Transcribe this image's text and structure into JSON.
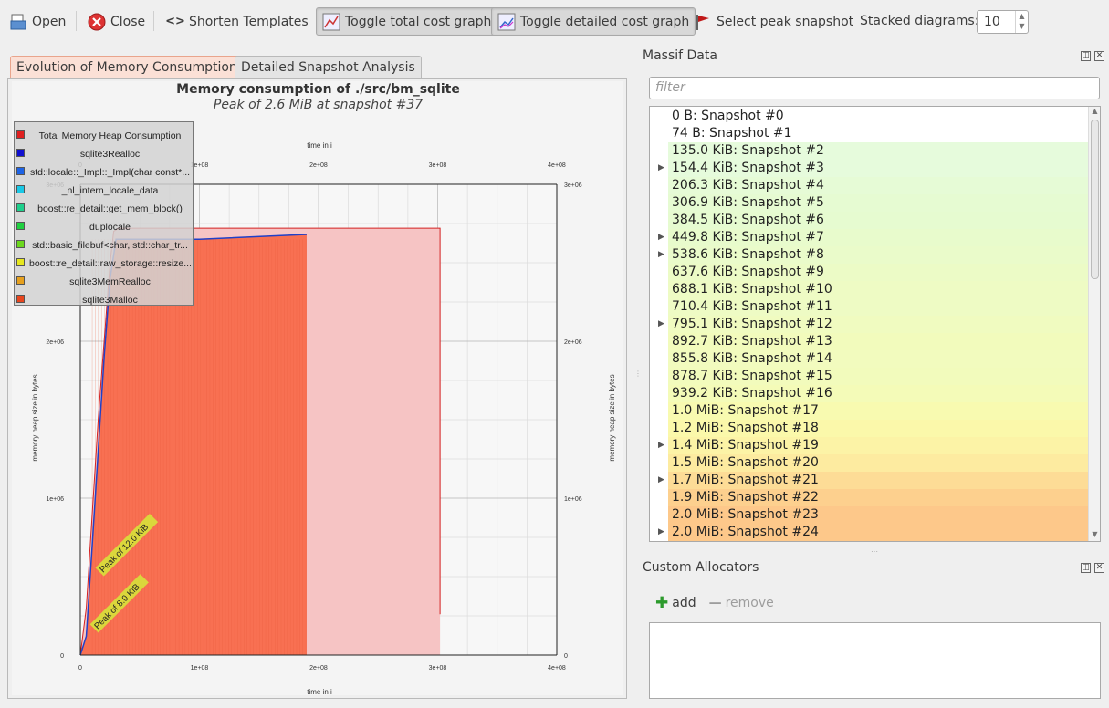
{
  "toolbar": {
    "open_label": "Open",
    "close_label": "Close",
    "shorten_label": "Shorten Templates",
    "toggle_total_label": "Toggle total cost graph",
    "toggle_detailed_label": "Toggle detailed cost graph",
    "select_peak_label": "Select peak snapshot",
    "stacked_label": "Stacked diagrams:",
    "stacked_value": "10"
  },
  "tabs": [
    {
      "label": "Evolution of Memory Consumption",
      "active": true
    },
    {
      "label": "Detailed Snapshot Analysis",
      "active": false
    }
  ],
  "chart": {
    "title": "Memory consumption of ./src/bm_sqlite",
    "subtitle": "Peak of 2.6 MiB at snapshot #37",
    "x_label_top": "time in i",
    "x_label_bottom": "time in i",
    "y_label_left": "memory heap size in bytes",
    "y_label_right": "memory heap size in bytes",
    "x_ticks": [
      "0",
      "1e+08",
      "2e+08",
      "3e+08",
      "4e+08"
    ],
    "y_ticks": [
      "0",
      "1e+06",
      "2e+06",
      "3e+06"
    ],
    "annotations": [
      "Peak of 12.0 KiB",
      "Peak of 8.0 KiB"
    ],
    "legend": [
      {
        "label": "Total Memory Heap Consumption",
        "color": "#e02020"
      },
      {
        "label": "sqlite3Realloc",
        "color": "#1010d0"
      },
      {
        "label": "std::locale::_Impl::_Impl(char const*...",
        "color": "#1e64e6"
      },
      {
        "label": "_nl_intern_locale_data",
        "color": "#19c8e6"
      },
      {
        "label": "boost::re_detail::get_mem_block()",
        "color": "#1ecf8c"
      },
      {
        "label": "duplocale",
        "color": "#20d040"
      },
      {
        "label": "std::basic_filebuf<char, std::char_tr...",
        "color": "#6cd81e"
      },
      {
        "label": "boost::re_detail::raw_storage::resize...",
        "color": "#e6e61e"
      },
      {
        "label": "sqlite3MemRealloc",
        "color": "#e6a01e"
      },
      {
        "label": "sqlite3Malloc",
        "color": "#e8461e"
      }
    ]
  },
  "chart_data": {
    "type": "area",
    "title": "Memory consumption of ./src/bm_sqlite",
    "subtitle": "Peak of 2.6 MiB at snapshot #37",
    "xlabel": "time in i",
    "ylabel": "memory heap size in bytes",
    "xlim": [
      0,
      400000000
    ],
    "ylim": [
      0,
      3000000
    ],
    "grid": true,
    "legend_position": "top-left",
    "series": [
      {
        "name": "Total Memory Heap Consumption",
        "x": [
          0,
          5000000,
          10000000,
          15000000,
          20000000,
          25000000,
          28000000,
          32000000,
          190000000,
          302000000,
          302000000
        ],
        "y": [
          0,
          300000,
          900000,
          1500000,
          2000000,
          2500000,
          2700000,
          2720000,
          2720000,
          2720000,
          260000
        ]
      },
      {
        "name": "sqlite3Realloc",
        "x": [
          0,
          5000000,
          10000000,
          15000000,
          20000000,
          25000000,
          30000000,
          100000000,
          190000000
        ],
        "y": [
          0,
          120000,
          700000,
          1300000,
          1900000,
          2400000,
          2650000,
          2650000,
          2680000
        ]
      }
    ]
  },
  "massif": {
    "title": "Massif Data",
    "filter_placeholder": "filter",
    "snapshots": [
      {
        "label": "0 B: Snapshot #0",
        "expandable": false,
        "color": "#ffffff"
      },
      {
        "label": "74 B: Snapshot #1",
        "expandable": false,
        "color": "#ffffff"
      },
      {
        "label": "135.0 KiB: Snapshot #2",
        "expandable": false,
        "color": "#e6fbdc"
      },
      {
        "label": "154.4 KiB: Snapshot #3",
        "expandable": true,
        "color": "#e6fbdc"
      },
      {
        "label": "206.3 KiB: Snapshot #4",
        "expandable": false,
        "color": "#e6fbd6"
      },
      {
        "label": "306.9 KiB: Snapshot #5",
        "expandable": false,
        "color": "#e6fbd2"
      },
      {
        "label": "384.5 KiB: Snapshot #6",
        "expandable": false,
        "color": "#e6fbd0"
      },
      {
        "label": "449.8 KiB: Snapshot #7",
        "expandable": true,
        "color": "#e8fbcc"
      },
      {
        "label": "538.6 KiB: Snapshot #8",
        "expandable": true,
        "color": "#eafbca"
      },
      {
        "label": "637.6 KiB: Snapshot #9",
        "expandable": false,
        "color": "#ecfbc6"
      },
      {
        "label": "688.1 KiB: Snapshot #10",
        "expandable": false,
        "color": "#eefbc4"
      },
      {
        "label": "710.4 KiB: Snapshot #11",
        "expandable": false,
        "color": "#eefbc4"
      },
      {
        "label": "795.1 KiB: Snapshot #12",
        "expandable": true,
        "color": "#f0fbc0"
      },
      {
        "label": "892.7 KiB: Snapshot #13",
        "expandable": false,
        "color": "#f2fbbc"
      },
      {
        "label": "855.8 KiB: Snapshot #14",
        "expandable": false,
        "color": "#f2fbbe"
      },
      {
        "label": "878.7 KiB: Snapshot #15",
        "expandable": false,
        "color": "#f2fbbc"
      },
      {
        "label": "939.2 KiB: Snapshot #16",
        "expandable": false,
        "color": "#f4fbb8"
      },
      {
        "label": "1.0 MiB: Snapshot #17",
        "expandable": false,
        "color": "#f8fab0"
      },
      {
        "label": "1.2 MiB: Snapshot #18",
        "expandable": false,
        "color": "#fbf8aa"
      },
      {
        "label": "1.4 MiB: Snapshot #19",
        "expandable": true,
        "color": "#fcf3a6"
      },
      {
        "label": "1.5 MiB: Snapshot #20",
        "expandable": false,
        "color": "#fdeba0"
      },
      {
        "label": "1.7 MiB: Snapshot #21",
        "expandable": true,
        "color": "#fddc96"
      },
      {
        "label": "1.9 MiB: Snapshot #22",
        "expandable": false,
        "color": "#fdd08e"
      },
      {
        "label": "2.0 MiB: Snapshot #23",
        "expandable": false,
        "color": "#fdc88a"
      },
      {
        "label": "2.0 MiB: Snapshot #24",
        "expandable": true,
        "color": "#fdc88a"
      }
    ]
  },
  "allocators": {
    "title": "Custom Allocators",
    "add_label": "add",
    "remove_label": "remove"
  }
}
